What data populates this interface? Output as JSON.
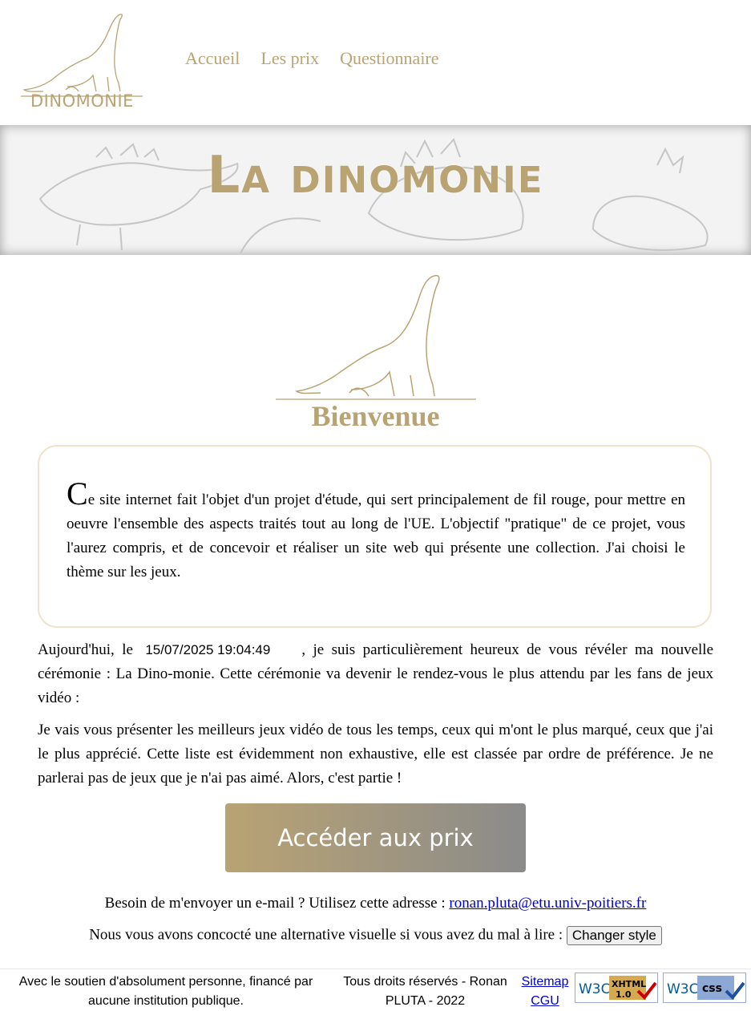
{
  "nav": {
    "items": [
      "Accueil",
      "Les prix",
      "Questionnaire"
    ]
  },
  "logo": {
    "text": "DINOMONIE"
  },
  "banner": {
    "title": "La dinomonie"
  },
  "welcome": "Bienvenue",
  "intro": {
    "dropcap": "C",
    "text": "e site internet fait l'objet d'un projet d'étude, qui sert principalement de fil rouge, pour mettre en oeuvre l'ensemble des aspects traités tout au long de l'UE. L'objectif \"pratique\" de ce projet, vous l'aurez compris, et de concevoir et réaliser un site web qui présente une collection. J'ai choisi le thème sur les jeux."
  },
  "today": {
    "prefix": "Aujourd'hui, le",
    "date": "15/07/2025 19:04:49",
    "suffix": ", je suis particulièrement heureux de vous révéler ma nouvelle cérémonie : La Dino-monie. Cette cérémonie va devenir le rendez-vous le plus attendu par les fans de jeux vidéo :"
  },
  "presentation": "Je vais vous présenter les meilleurs jeux vidéo de tous les temps, ceux qui m'ont le plus marqué, ceux que j'ai le plus apprécié. Cette liste est évidemment non exhaustive, elle est classée par ordre de préférence. Je ne parlerai pas de jeux que je n'ai pas aimé. Alors, c'est partie !",
  "cta": {
    "label": "Accéder aux prix"
  },
  "contact": {
    "text": "Besoin de m'envoyer un e-mail ? Utilisez cette adresse :",
    "email": "ronan.pluta@etu.univ-poitiers.fr"
  },
  "style_switch": {
    "text": "Nous vous avons concocté une alternative visuelle si vous avez du mal à lire :",
    "button": "Changer style"
  },
  "footer": {
    "support": "Avec le soutien d'absolument personne, financé par aucune institution publique.",
    "rights": "Tous droits réservés - Ronan PLUTA - 2022",
    "links": [
      "Sitemap",
      "CGU"
    ],
    "badges": [
      {
        "icon": "w3c-xhtml-badge-icon",
        "brand": "W3C",
        "label": "XHTML",
        "version": "1.0"
      },
      {
        "icon": "w3c-css-badge-icon",
        "brand": "W3C",
        "label": "css"
      }
    ]
  },
  "colors": {
    "accent": "#b9a373",
    "cta_end": "#8b8b8b",
    "box_border": "#f1e2cc"
  }
}
